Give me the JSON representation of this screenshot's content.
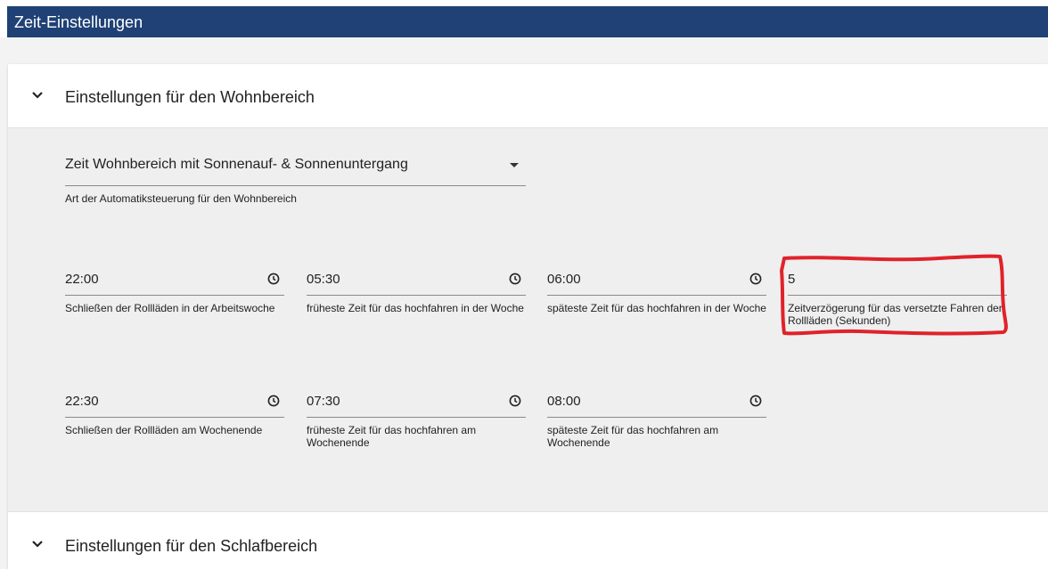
{
  "header": {
    "title": "Zeit-Einstellungen"
  },
  "section_living": {
    "title": "Einstellungen für den Wohnbereich",
    "mode_select": {
      "value": "Zeit Wohnbereich mit Sonnenauf- & Sonnenuntergang",
      "helper": "Art der Automatiksteuerung für den Wohnbereich"
    },
    "fields": [
      {
        "value": "22:00",
        "label": "Schließen der Rollläden in der Arbeitswoche",
        "icon": "clock-icon"
      },
      {
        "value": "05:30",
        "label": "früheste Zeit für das hochfahren in der Woche",
        "icon": "clock-icon"
      },
      {
        "value": "06:00",
        "label": "späteste Zeit für das hochfahren in der Woche",
        "icon": "clock-icon"
      },
      {
        "value": "5",
        "label": "Zeitverzögerung für das versetzte Fahren der Rollläden (Sekunden)"
      },
      {
        "value": "22:30",
        "label": "Schließen der Rollläden am Wochenende",
        "icon": "clock-icon"
      },
      {
        "value": "07:30",
        "label": "früheste Zeit für das hochfahren am Wochenende",
        "icon": "clock-icon"
      },
      {
        "value": "08:00",
        "label": "späteste Zeit für das hochfahren am Wochenende",
        "icon": "clock-icon"
      }
    ]
  },
  "section_sleep": {
    "title": "Einstellungen für den Schlafbereich"
  },
  "colors": {
    "header_bg": "#1f4175",
    "highlight": "#e0222a",
    "panel_bg": "#efefef"
  }
}
